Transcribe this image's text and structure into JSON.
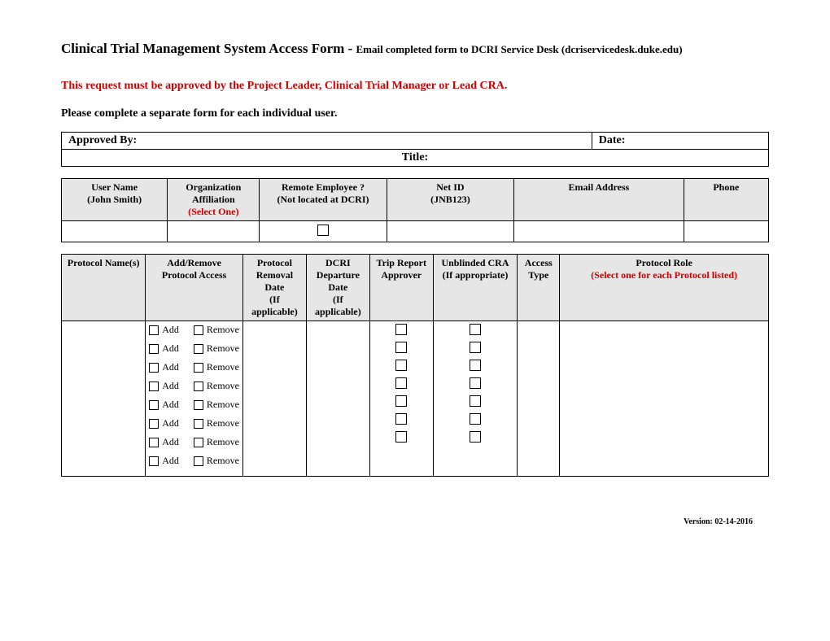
{
  "title_main": "Clinical Trial Management System Access Form - ",
  "title_sub": "Email completed form to DCRI Service Desk (dcriservicedesk.duke.edu)",
  "red_note": "This request must be approved by the Project Leader, Clinical Trial Manager or Lead CRA.",
  "instruction": "Please complete a separate form for each individual user.",
  "approve": {
    "by_label": "Approved By",
    "date_label": "Date:",
    "title_label": "Title:"
  },
  "user_headers": {
    "name": "User Name",
    "name_eg": "(John Smith)",
    "org": "Organization Affiliation",
    "org_sel": "(Select One)",
    "remote": "Remote Employee ?",
    "remote_eg": "(Not located at DCRI)",
    "netid": "Net ID",
    "netid_eg": "(JNB123)",
    "email": "Email Address",
    "phone": "Phone"
  },
  "proto_headers": {
    "names": "Protocol Name(s)",
    "addrem": "Add/Remove Protocol Access",
    "premove": "Protocol Removal Date",
    "premove2": "(If applicable)",
    "depart": "DCRI Departure Date",
    "depart2": "(If applicable)",
    "trip": "Trip Report Approver",
    "unblind": "Unblinded CRA",
    "unblind2": "(If appropriate)",
    "acc": "Access Type",
    "role": "Protocol Role",
    "role_sel": "(Select one for each Protocol listed)"
  },
  "labels": {
    "add": "Add",
    "remove": "Remove"
  },
  "row_count": 8,
  "checkbox_rows": 7,
  "version": "Version: 02-14-2016"
}
